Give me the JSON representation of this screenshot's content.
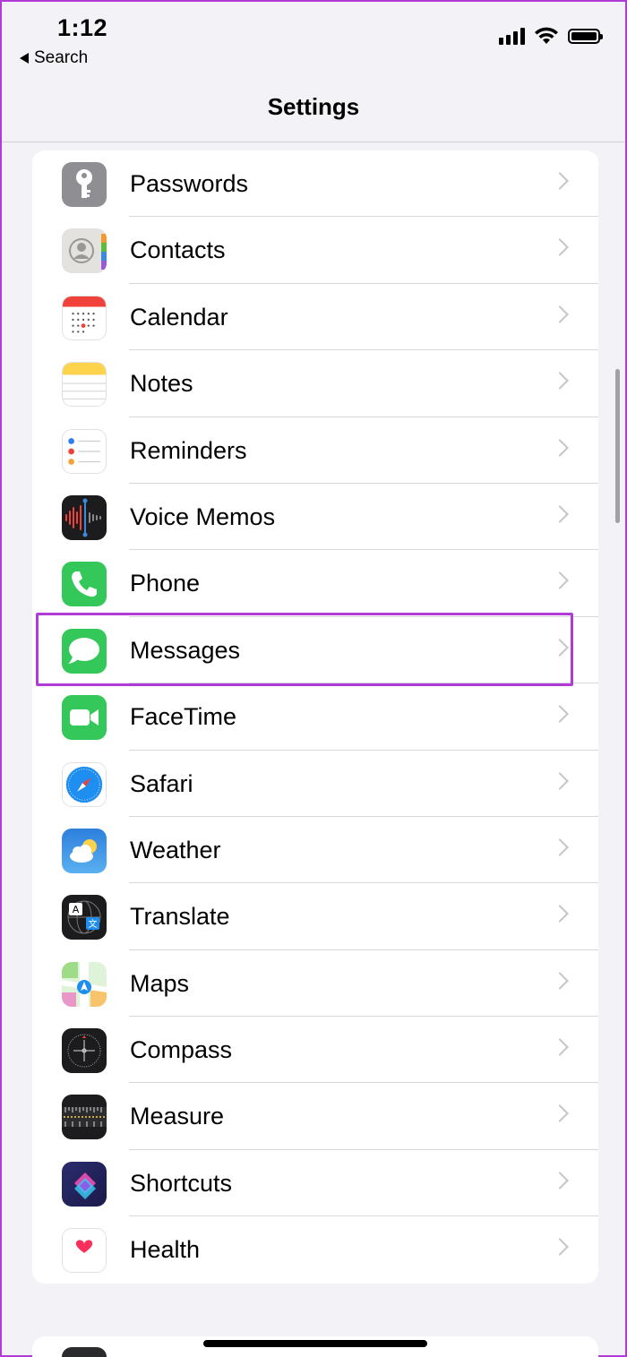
{
  "status_bar": {
    "time": "1:12",
    "back_label": "Search",
    "icons": [
      "signal-icon",
      "wifi-icon",
      "battery-icon"
    ]
  },
  "nav": {
    "title": "Settings"
  },
  "settings_items": [
    {
      "label": "Passwords",
      "icon": "key-icon"
    },
    {
      "label": "Contacts",
      "icon": "contacts-icon"
    },
    {
      "label": "Calendar",
      "icon": "calendar-icon"
    },
    {
      "label": "Notes",
      "icon": "notes-icon"
    },
    {
      "label": "Reminders",
      "icon": "reminders-icon"
    },
    {
      "label": "Voice Memos",
      "icon": "voice-memos-icon"
    },
    {
      "label": "Phone",
      "icon": "phone-icon"
    },
    {
      "label": "Messages",
      "icon": "messages-icon",
      "highlighted": true
    },
    {
      "label": "FaceTime",
      "icon": "facetime-icon"
    },
    {
      "label": "Safari",
      "icon": "safari-icon"
    },
    {
      "label": "Weather",
      "icon": "weather-icon"
    },
    {
      "label": "Translate",
      "icon": "translate-icon"
    },
    {
      "label": "Maps",
      "icon": "maps-icon"
    },
    {
      "label": "Compass",
      "icon": "compass-icon"
    },
    {
      "label": "Measure",
      "icon": "measure-icon"
    },
    {
      "label": "Shortcuts",
      "icon": "shortcuts-icon"
    },
    {
      "label": "Health",
      "icon": "health-icon"
    }
  ],
  "colors": {
    "highlight": "#b13bd6",
    "background": "#f2f2f7",
    "separator": "#d8d8dc"
  }
}
